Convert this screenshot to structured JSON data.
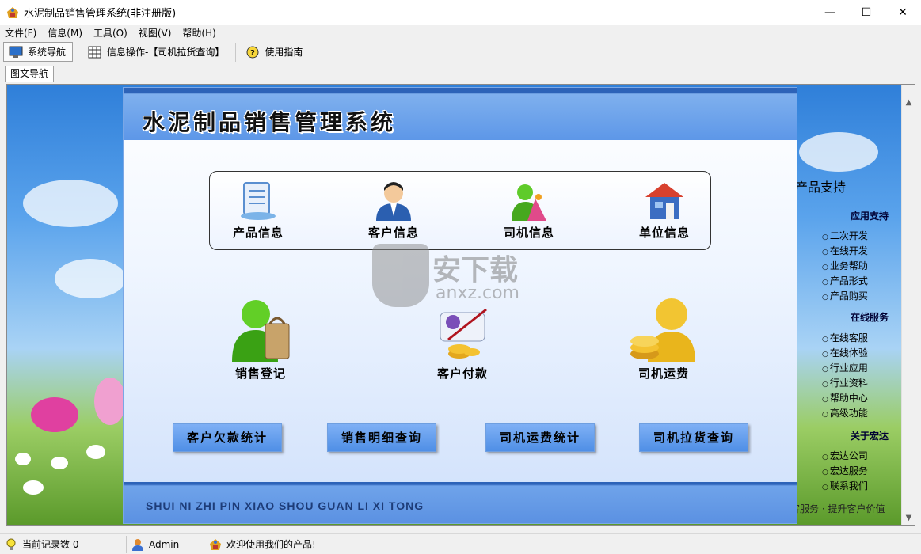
{
  "window": {
    "title": "水泥制品销售管理系统(非注册版)",
    "minimize_glyph": "—",
    "maximize_glyph": "☐",
    "close_glyph": "✕"
  },
  "menubar": {
    "items": [
      "文件(F)",
      "信息(M)",
      "工具(O)",
      "视图(V)",
      "帮助(H)"
    ]
  },
  "toolbar": {
    "items": [
      {
        "label": "系统导航",
        "icon": "monitor-icon"
      },
      {
        "label": "信息操作-【司机拉货查询】",
        "icon": "grid-icon"
      },
      {
        "label": "使用指南",
        "icon": "help-icon"
      }
    ]
  },
  "tabs": {
    "active": "图文导航"
  },
  "panel": {
    "system_title": "水泥制品销售管理系统",
    "modules_top": [
      {
        "label": "产品信息",
        "icon": "document-icon"
      },
      {
        "label": "客户信息",
        "icon": "person-icon"
      },
      {
        "label": "司机信息",
        "icon": "driver-icon"
      },
      {
        "label": "单位信息",
        "icon": "house-icon"
      }
    ],
    "modules_mid": [
      {
        "label": "销售登记",
        "icon": "shopping-icon"
      },
      {
        "label": "客户付款",
        "icon": "payment-icon"
      },
      {
        "label": "司机运费",
        "icon": "coins-icon"
      }
    ],
    "buttons": [
      "客户欠款统计",
      "销售明细查询",
      "司机运费统计",
      "司机拉货查询"
    ],
    "pinyin": "SHUI NI ZHI PIN XIAO SHOU GUAN LI XI TONG"
  },
  "support": {
    "title": "产品支持",
    "sections": [
      {
        "name": "应用支持",
        "links": [
          "二次开发",
          "在线开发",
          "业务帮助",
          "产品形式",
          "产品购买"
        ]
      },
      {
        "name": "在线服务",
        "links": [
          "在线客服",
          "在线体验",
          "行业应用",
          "行业资料",
          "帮助中心",
          "高级功能"
        ]
      },
      {
        "name": "关于宏达",
        "links": [
          "宏达公司",
          "宏达服务",
          "联系我们"
        ]
      }
    ],
    "footer": "客服务 · 提升客户价值"
  },
  "watermark": {
    "text_cn": "安下载",
    "text_en": "anxz.com"
  },
  "statusbar": {
    "record_label": "当前记录数 0",
    "user": "Admin",
    "welcome": "欢迎使用我们的产品!"
  },
  "colors": {
    "accent": "#2d63b8",
    "button": "#5f9bea",
    "header": "#5d97e8"
  }
}
